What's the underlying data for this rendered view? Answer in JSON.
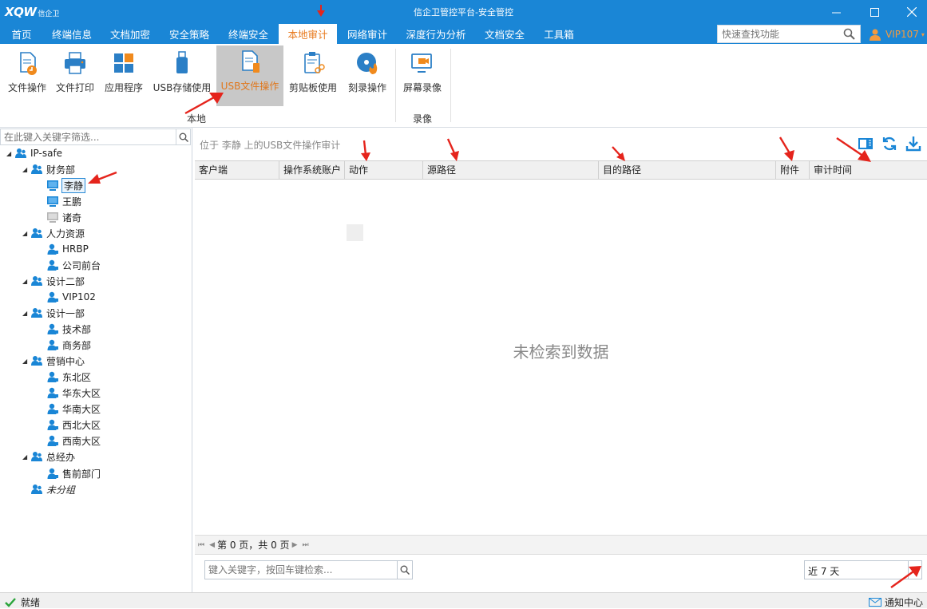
{
  "titlebar": {
    "logo_text": "XQW",
    "logo_brand": "信企卫",
    "title": "信企卫管控平台-安全管控",
    "colors": {
      "bar": "#1a86d6",
      "accent": "#e87a1e"
    }
  },
  "menu": {
    "tabs": [
      "首页",
      "终端信息",
      "文档加密",
      "安全策略",
      "终端安全",
      "本地审计",
      "网络审计",
      "深度行为分析",
      "文档安全",
      "工具箱"
    ],
    "active": "本地审计",
    "search_placeholder": "快速查找功能",
    "user": "VIP107"
  },
  "ribbon": {
    "groups": [
      {
        "label": "本地",
        "items": [
          "文件操作",
          "文件打印",
          "应用程序",
          "USB存储使用",
          "USB文件操作",
          "剪贴板使用",
          "刻录操作"
        ]
      },
      {
        "label": "录像",
        "items": [
          "屏幕录像"
        ]
      }
    ],
    "selected": "USB文件操作"
  },
  "tree": {
    "search_placeholder": "在此键入关键字筛选...",
    "root": "IP-safe",
    "nodes": [
      "财务部",
      "李静",
      "王鹏",
      "诸奇",
      "人力资源",
      "HRBP",
      "公司前台",
      "设计二部",
      "VIP102",
      "设计一部",
      "技术部",
      "商务部",
      "营销中心",
      "东北区",
      "华东大区",
      "华南大区",
      "西北大区",
      "西南大区",
      "总经办",
      "售前部门",
      "未分组"
    ],
    "selected": "李静"
  },
  "main": {
    "location": "位于 李静 上的USB文件操作审计",
    "columns": [
      "客户端",
      "操作系统账户",
      "动作",
      "源路径",
      "目的路径",
      "附件",
      "审计时间"
    ],
    "empty_message": "未检索到数据",
    "pager": {
      "text": "第 0 页，共 0 页"
    },
    "keyword_placeholder": "键入关键字，按回车键检索...",
    "range": "近 7 天"
  },
  "statusbar": {
    "status": "就绪",
    "notify": "通知中心"
  }
}
